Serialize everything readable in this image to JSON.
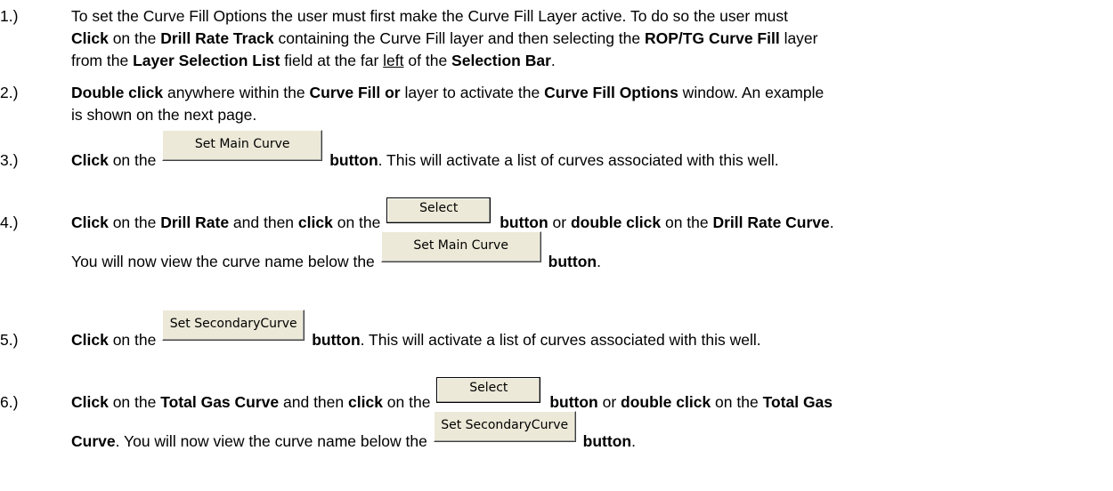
{
  "steps": [
    {
      "number": "1.)",
      "line1_a": "To set the Curve Fill Options the user must first make the Curve Fill Layer active. To do so the user must",
      "line2_bold1": "Click",
      "line2_a": " on the ",
      "line2_bold2": "Drill Rate Track",
      "line2_b": " containing the Curve Fill layer and then selecting the ",
      "line2_bold3": "ROP/TG Curve Fill",
      "line2_c": " layer",
      "line3_a": "from the ",
      "line3_bold1": "Layer Selection List",
      "line3_b": " field at the far ",
      "line3_underline": "left",
      "line3_c": " of the ",
      "line3_bold2": "Selection Bar",
      "line3_d": "."
    },
    {
      "number": "2.)",
      "bold1": "Double click",
      "text_a": " anywhere within the ",
      "bold2": "Curve Fill or",
      "text_b": " layer to activate the ",
      "bold3": "Curve Fill Options",
      "text_c": " window. An example",
      "line2": "is shown on the next page."
    },
    {
      "number": "3.)",
      "bold1": "Click",
      "text_a": " on the ",
      "button_label": "Set Main Curve",
      "bold2": "button",
      "text_b": ". This will activate a list of curves associated with this well."
    },
    {
      "number": "4.)",
      "bold1": "Click",
      "text_a": " on the ",
      "bold2": "Drill Rate",
      "text_b": " and then ",
      "bold3": "click",
      "text_c": " on the ",
      "button_label": "Select",
      "bold4": "button",
      "text_d": " or ",
      "bold5": "double click",
      "text_e": " on the ",
      "bold6": "Drill Rate Curve",
      "text_f": ".",
      "line2_a": "You will now view the curve name below the ",
      "line2_button_label": "Set Main Curve",
      "line2_bold": "button",
      "line2_b": "."
    },
    {
      "number": "5.)",
      "bold1": "Click",
      "text_a": " on the ",
      "button_label": "Set SecondaryCurve",
      "bold2": "button",
      "text_b": ". This will activate a list of curves associated with this well."
    },
    {
      "number": "6.)",
      "bold1": "Click",
      "text_a": " on the ",
      "bold2": "Total Gas Curve",
      "text_b": " and then ",
      "bold3": "click",
      "text_c": " on the ",
      "button_label": "Select",
      "bold4": "button",
      "text_d": " or ",
      "bold5": "double click",
      "text_e": " on the ",
      "bold6": "Total Gas",
      "line2_bold": "Curve",
      "line2_a": ". You will now view the curve name below the ",
      "line2_button_label": "Set SecondaryCurve",
      "line2_bold2": "button",
      "line2_b": "."
    }
  ]
}
